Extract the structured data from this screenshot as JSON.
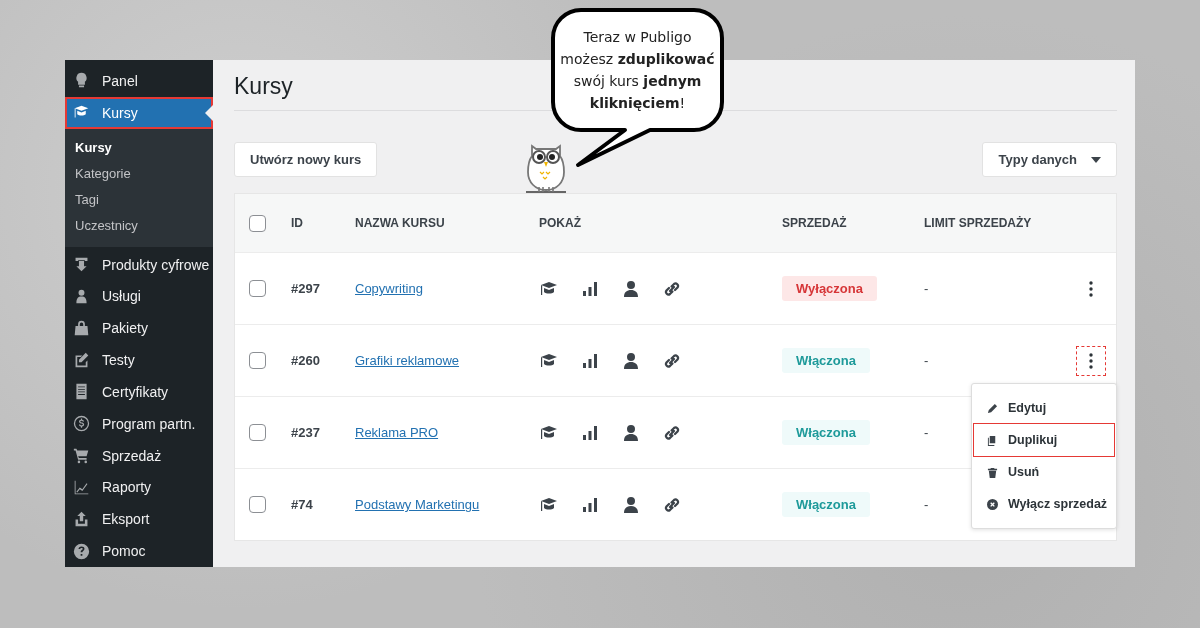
{
  "speech_bubble": {
    "text": "Teraz w Publigo możesz **zduplikować** swój kurs **jednym kliknięciem**!"
  },
  "sidebar": {
    "items": [
      {
        "label": "Panel",
        "selected": false,
        "highlighted": false
      },
      {
        "label": "Kursy",
        "selected": true,
        "highlighted": true,
        "children": [
          {
            "label": "Kursy",
            "selected": true
          },
          {
            "label": "Kategorie",
            "selected": false
          },
          {
            "label": "Tagi",
            "selected": false
          },
          {
            "label": "Uczestnicy",
            "selected": false
          }
        ]
      },
      {
        "label": "Produkty cyfrowe",
        "selected": false,
        "highlighted": false
      },
      {
        "label": "Usługi",
        "selected": false,
        "highlighted": false
      },
      {
        "label": "Pakiety",
        "selected": false,
        "highlighted": false
      },
      {
        "label": "Testy",
        "selected": false,
        "highlighted": false
      },
      {
        "label": "Certyfikaty",
        "selected": false,
        "highlighted": false
      },
      {
        "label": "Program partn.",
        "selected": false,
        "highlighted": false
      },
      {
        "label": "Sprzedaż",
        "selected": false,
        "highlighted": false
      },
      {
        "label": "Raporty",
        "selected": false,
        "highlighted": false
      },
      {
        "label": "Eksport",
        "selected": false,
        "highlighted": false
      },
      {
        "label": "Pomoc",
        "selected": false,
        "highlighted": false
      }
    ]
  },
  "page_title": "Kursy",
  "new_button": "Utwórz nowy kurs",
  "type_dropdown": "Typy danych",
  "table": {
    "columns": [
      "ID",
      "NAZWA KURSU",
      "POKAŻ",
      "SPRZEDAŻ",
      "LIMIT SPRZEDAŻY"
    ],
    "header_checked": false,
    "rows": [
      {
        "checked": false,
        "id": "#297",
        "name": "Copywriting",
        "sale": {
          "label": "Wyłączona",
          "kind": "off"
        },
        "limit": "-",
        "menu_highlighted": false
      },
      {
        "checked": false,
        "id": "#260",
        "name": "Grafiki reklamowe",
        "sale": {
          "label": "Włączona",
          "kind": "on"
        },
        "limit": "-",
        "menu_highlighted": true
      },
      {
        "checked": false,
        "id": "#237",
        "name": "Reklama PRO",
        "sale": {
          "label": "Włączona",
          "kind": "on"
        },
        "limit": "-"
      },
      {
        "checked": false,
        "id": "#74",
        "name": "Podstawy Marketingu",
        "sale": {
          "label": "Włączona",
          "kind": "on"
        },
        "limit": "-"
      }
    ]
  },
  "row_menu": {
    "items": [
      {
        "label": "Edytuj",
        "highlighted": false
      },
      {
        "label": "Duplikuj",
        "highlighted": true
      },
      {
        "label": "Usuń",
        "highlighted": false
      },
      {
        "label": "Wyłącz sprzedaż",
        "highlighted": false
      }
    ]
  }
}
